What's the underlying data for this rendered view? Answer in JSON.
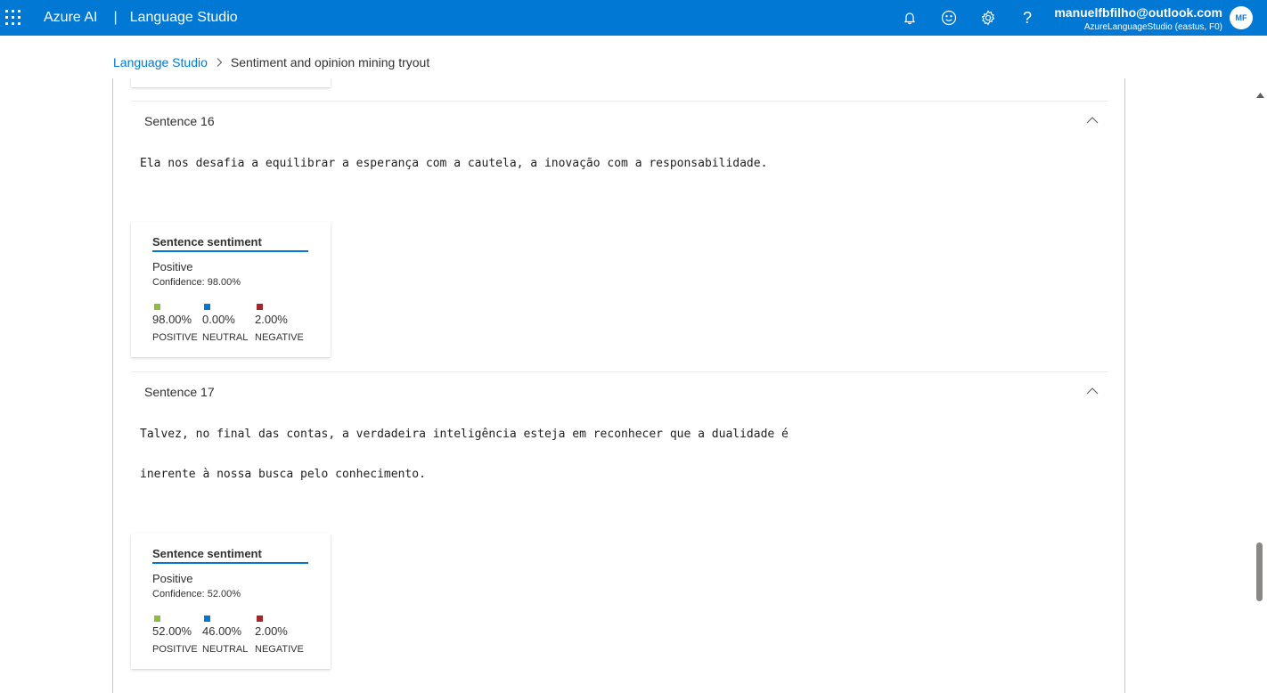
{
  "header": {
    "brand": "Azure AI",
    "separator": "|",
    "product": "Language Studio",
    "account_email": "manuelfbfilho@outlook.com",
    "account_resource": "AzureLanguageStudio (eastus, F0)",
    "avatar_initials": "MF",
    "help_label": "?"
  },
  "breadcrumb": {
    "root": "Language Studio",
    "current": "Sentiment and opinion mining tryout"
  },
  "colors": {
    "brand": "#0078d4",
    "positive": "#8cbd3f",
    "neutral": "#0078d4",
    "negative": "#a4262c"
  },
  "sentences": [
    {
      "title": "Sentence 16",
      "lines": [
        "Ela nos desafia a equilibrar a esperança com a cautela, a inovação com a responsabilidade."
      ],
      "card": {
        "tab": "Sentence sentiment",
        "label": "Positive",
        "confidence": "Confidence: 98.00%",
        "metrics": [
          {
            "value": "98.00%",
            "caption": "POSITIVE"
          },
          {
            "value": "0.00%",
            "caption": "NEUTRAL"
          },
          {
            "value": "2.00%",
            "caption": "NEGATIVE"
          }
        ]
      }
    },
    {
      "title": "Sentence 17",
      "lines": [
        "Talvez, no final das contas, a verdadeira inteligência esteja em reconhecer que a dualidade é",
        "inerente à nossa busca pelo conhecimento."
      ],
      "card": {
        "tab": "Sentence sentiment",
        "label": "Positive",
        "confidence": "Confidence: 52.00%",
        "metrics": [
          {
            "value": "52.00%",
            "caption": "POSITIVE"
          },
          {
            "value": "46.00%",
            "caption": "NEUTRAL"
          },
          {
            "value": "2.00%",
            "caption": "NEGATIVE"
          }
        ]
      }
    }
  ]
}
